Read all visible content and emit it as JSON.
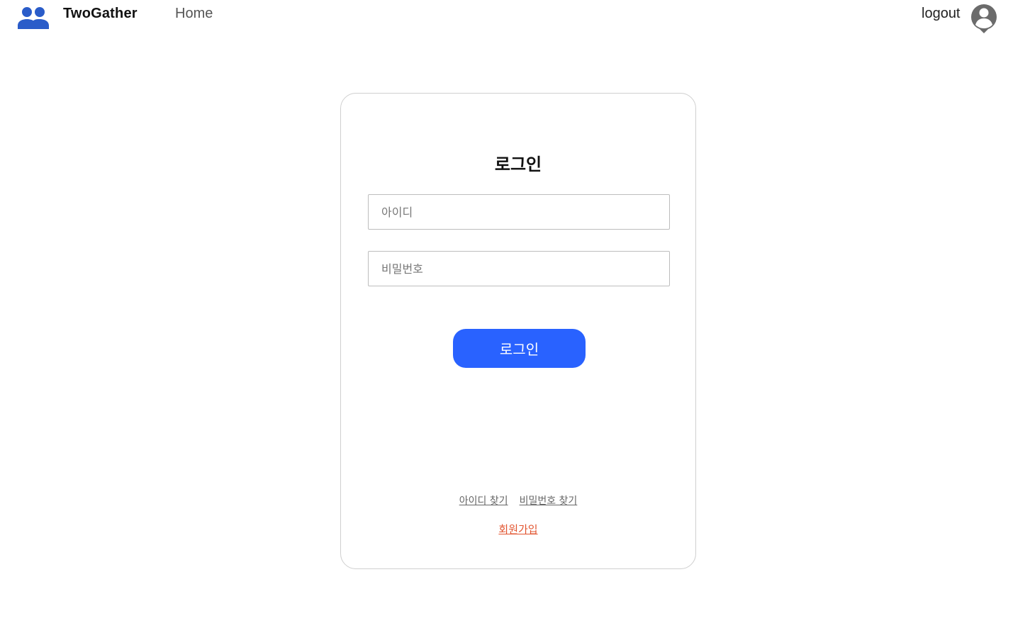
{
  "header": {
    "brand": "TwoGather",
    "nav_home": "Home",
    "logout_label": "logout",
    "logo_icon": "people-group-icon",
    "avatar_icon": "user-account-icon",
    "brand_color": "#2a5cc9",
    "avatar_color": "#6b6b6b"
  },
  "login": {
    "title": "로그인",
    "id_placeholder": "아이디",
    "id_value": "",
    "password_placeholder": "비밀번호",
    "password_value": "",
    "submit_label": "로그인",
    "button_color": "#2962ff",
    "find_id_link": "아이디 찾기",
    "find_password_link": "비밀번호 찾기",
    "signup_link": "회원가입",
    "signup_color": "#e2542f"
  }
}
